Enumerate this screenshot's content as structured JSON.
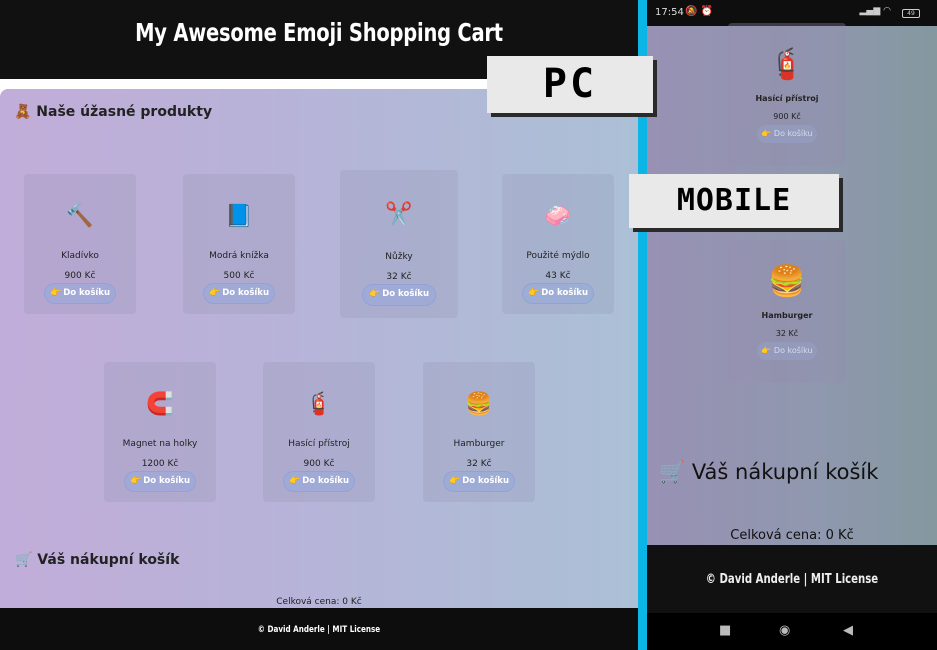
{
  "pc": {
    "title": "My Awesome Emoji Shopping Cart",
    "products_title": "🧸 Naše úžasné produkty",
    "cart_title": "🛒 Váš nákupní košík",
    "total": "Celková cena: 0 Kč",
    "footer": "© David Anderle | MIT License",
    "add_label": "Do košíku",
    "products": [
      {
        "icon": "🔨",
        "name": "Kladívko",
        "price": "900 Kč"
      },
      {
        "icon": "📘",
        "name": "Modrá knížka",
        "price": "500 Kč"
      },
      {
        "icon": "✂️",
        "name": "Nůžky",
        "price": "32 Kč"
      },
      {
        "icon": "🧼",
        "name": "Použité mýdlo",
        "price": "43 Kč"
      },
      {
        "icon": "🧲",
        "name": "Magnet na holky",
        "price": "1200 Kč"
      },
      {
        "icon": "🧯",
        "name": "Hasící přístroj",
        "price": "900 Kč"
      },
      {
        "icon": "🍔",
        "name": "Hamburger",
        "price": "32 Kč"
      }
    ]
  },
  "labels": {
    "pc": "PC",
    "mobile": "MOBILE"
  },
  "mobile": {
    "status_time": "17:54",
    "battery": "49",
    "products": [
      {
        "icon": "🧯",
        "name": "Hasící přístroj",
        "price": "900 Kč"
      },
      {
        "icon": "🍔",
        "name": "Hamburger",
        "price": "32 Kč"
      }
    ],
    "add_label": "Do košíku",
    "cart_title": "🛒 Váš nákupní košík",
    "total": "Celková cena: 0 Kč",
    "footer": "© David Anderle | MIT License"
  },
  "colors": {
    "divider": "#0bb6e6",
    "header": "#111111"
  }
}
